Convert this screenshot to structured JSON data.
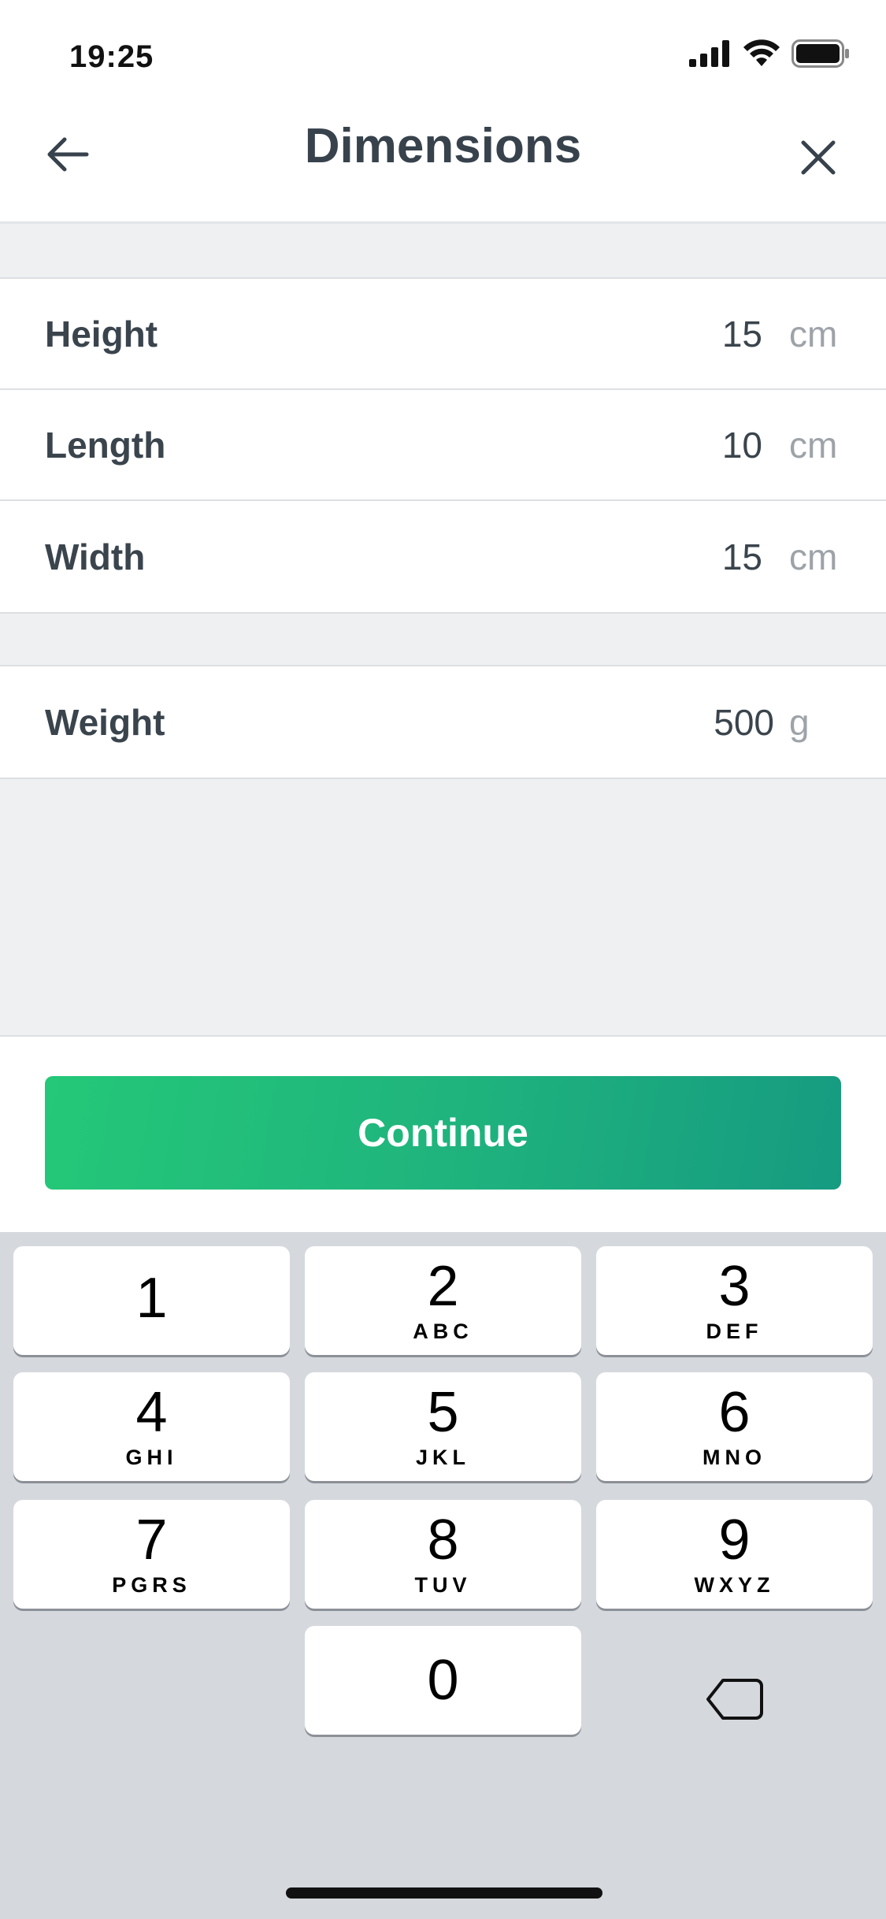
{
  "status": {
    "time": "19:25"
  },
  "nav": {
    "title": "Dimensions"
  },
  "dimensions": [
    {
      "label": "Height",
      "value": "15",
      "unit": "cm"
    },
    {
      "label": "Length",
      "value": "10",
      "unit": "cm"
    },
    {
      "label": "Width",
      "value": "15",
      "unit": "cm"
    }
  ],
  "weight": {
    "label": "Weight",
    "value": "500",
    "unit": "g"
  },
  "actions": {
    "continue_label": "Continue"
  },
  "colors": {
    "accent_start": "#24c878",
    "accent_end": "#169b81",
    "text": "#37424c",
    "unit": "#9da3a8"
  },
  "keypad": [
    {
      "digit": "1",
      "letters": ""
    },
    {
      "digit": "2",
      "letters": "ABC"
    },
    {
      "digit": "3",
      "letters": "DEF"
    },
    {
      "digit": "4",
      "letters": "GHI"
    },
    {
      "digit": "5",
      "letters": "JKL"
    },
    {
      "digit": "6",
      "letters": "MNO"
    },
    {
      "digit": "7",
      "letters": "PGRS"
    },
    {
      "digit": "8",
      "letters": "TUV"
    },
    {
      "digit": "9",
      "letters": "WXYZ"
    },
    {
      "digit": "0",
      "letters": ""
    }
  ]
}
